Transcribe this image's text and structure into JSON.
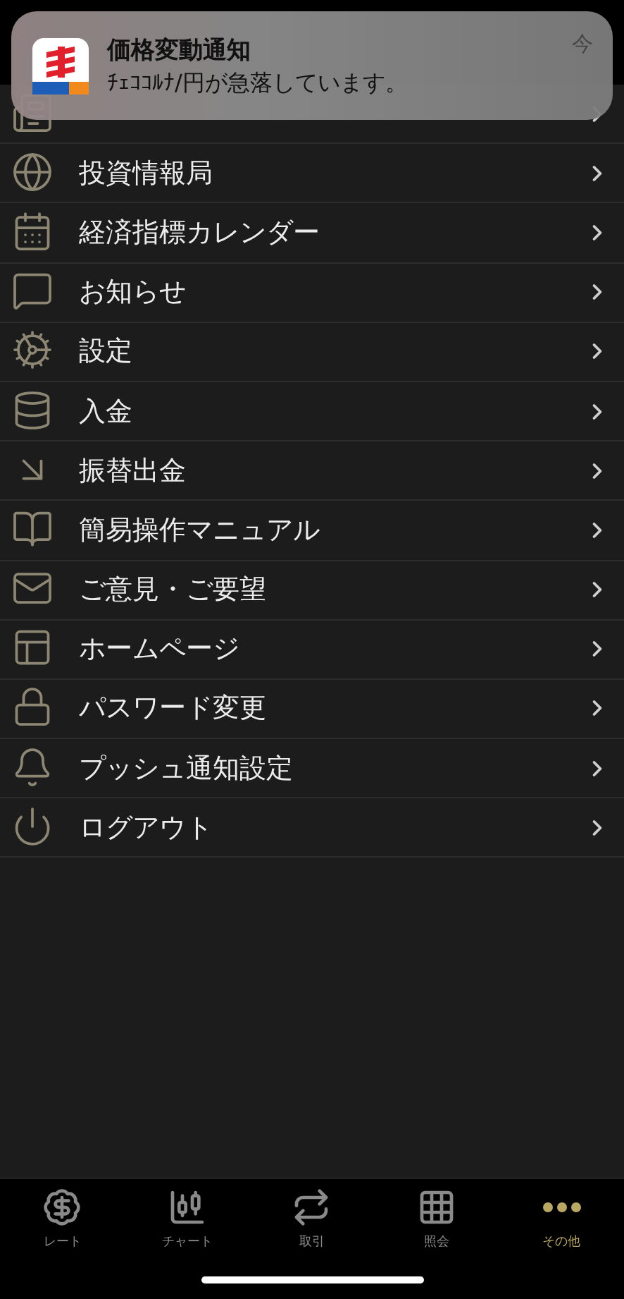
{
  "notification": {
    "title": "価格変動通知",
    "message": "ﾁｪｺｺﾙﾅ/円が急落しています。",
    "time": "今"
  },
  "menu": {
    "items": [
      {
        "label": "投資情報局"
      },
      {
        "label": "経済指標カレンダー"
      },
      {
        "label": "お知らせ"
      },
      {
        "label": "設定"
      },
      {
        "label": "入金"
      },
      {
        "label": "振替出金"
      },
      {
        "label": "簡易操作マニュアル"
      },
      {
        "label": "ご意見・ご要望"
      },
      {
        "label": "ホームページ"
      },
      {
        "label": "パスワード変更"
      },
      {
        "label": "プッシュ通知設定"
      },
      {
        "label": "ログアウト"
      }
    ]
  },
  "tab_bar": {
    "tabs": [
      {
        "label": "レート",
        "selected": false
      },
      {
        "label": "チャート",
        "selected": false
      },
      {
        "label": "取引",
        "selected": false
      },
      {
        "label": "照会",
        "selected": false
      },
      {
        "label": "その他",
        "selected": true
      }
    ]
  }
}
